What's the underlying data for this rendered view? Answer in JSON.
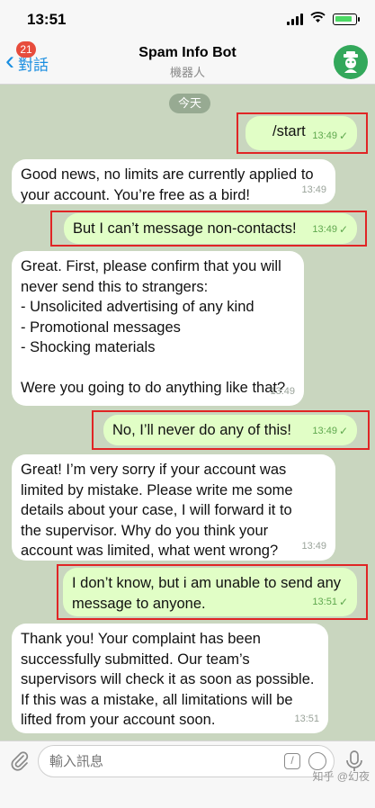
{
  "status_bar": {
    "time": "13:51"
  },
  "nav": {
    "back_label": "對話",
    "unread_badge": "21",
    "title": "Spam Info Bot",
    "subtitle": "機器人"
  },
  "chat": {
    "day_label": "今天",
    "messages": [
      {
        "direction": "out",
        "text": "/start",
        "time": "13:49",
        "read": true
      },
      {
        "direction": "in",
        "text": "Good news, no limits are currently applied to\nyour account. You’re free as a bird!",
        "time": "13:49"
      },
      {
        "direction": "out",
        "text": "But I can’t message non-contacts!",
        "time": "13:49",
        "read": true
      },
      {
        "direction": "in",
        "text": "Great. First, please confirm that you will\nnever send this to strangers:\n- Unsolicited advertising of any kind\n- Promotional messages\n- Shocking materials\n\nWere you going to do anything like that?",
        "time": "13:49"
      },
      {
        "direction": "out",
        "text": "No, I’ll never do any of this!",
        "time": "13:49",
        "read": true
      },
      {
        "direction": "in",
        "text": "Great! I’m very sorry if your account was\nlimited by mistake. Please write me some\ndetails about your case, I will forward it to\nthe supervisor. Why do you think your\naccount was limited, what went wrong?",
        "time": "13:49"
      },
      {
        "direction": "out",
        "text": "I don’t know, but i am unable to send any\nmessage to anyone.",
        "time": "13:51",
        "read": true
      },
      {
        "direction": "in",
        "text": "Thank you! Your complaint has been\nsuccessfully submitted. Our team’s\nsupervisors will check it as soon as possible.\nIf this was a mistake, all limitations will be\nlifted from your account soon.",
        "time": "13:51"
      }
    ]
  },
  "input": {
    "placeholder": "輸入訊息",
    "watermark": "知乎 @幻夜"
  },
  "colors": {
    "accent": "#1a8ee0",
    "outgoing_bubble": "#e1fec6",
    "incoming_bubble": "#ffffff",
    "highlight_box": "#e02525",
    "badge": "#e74c3c"
  }
}
